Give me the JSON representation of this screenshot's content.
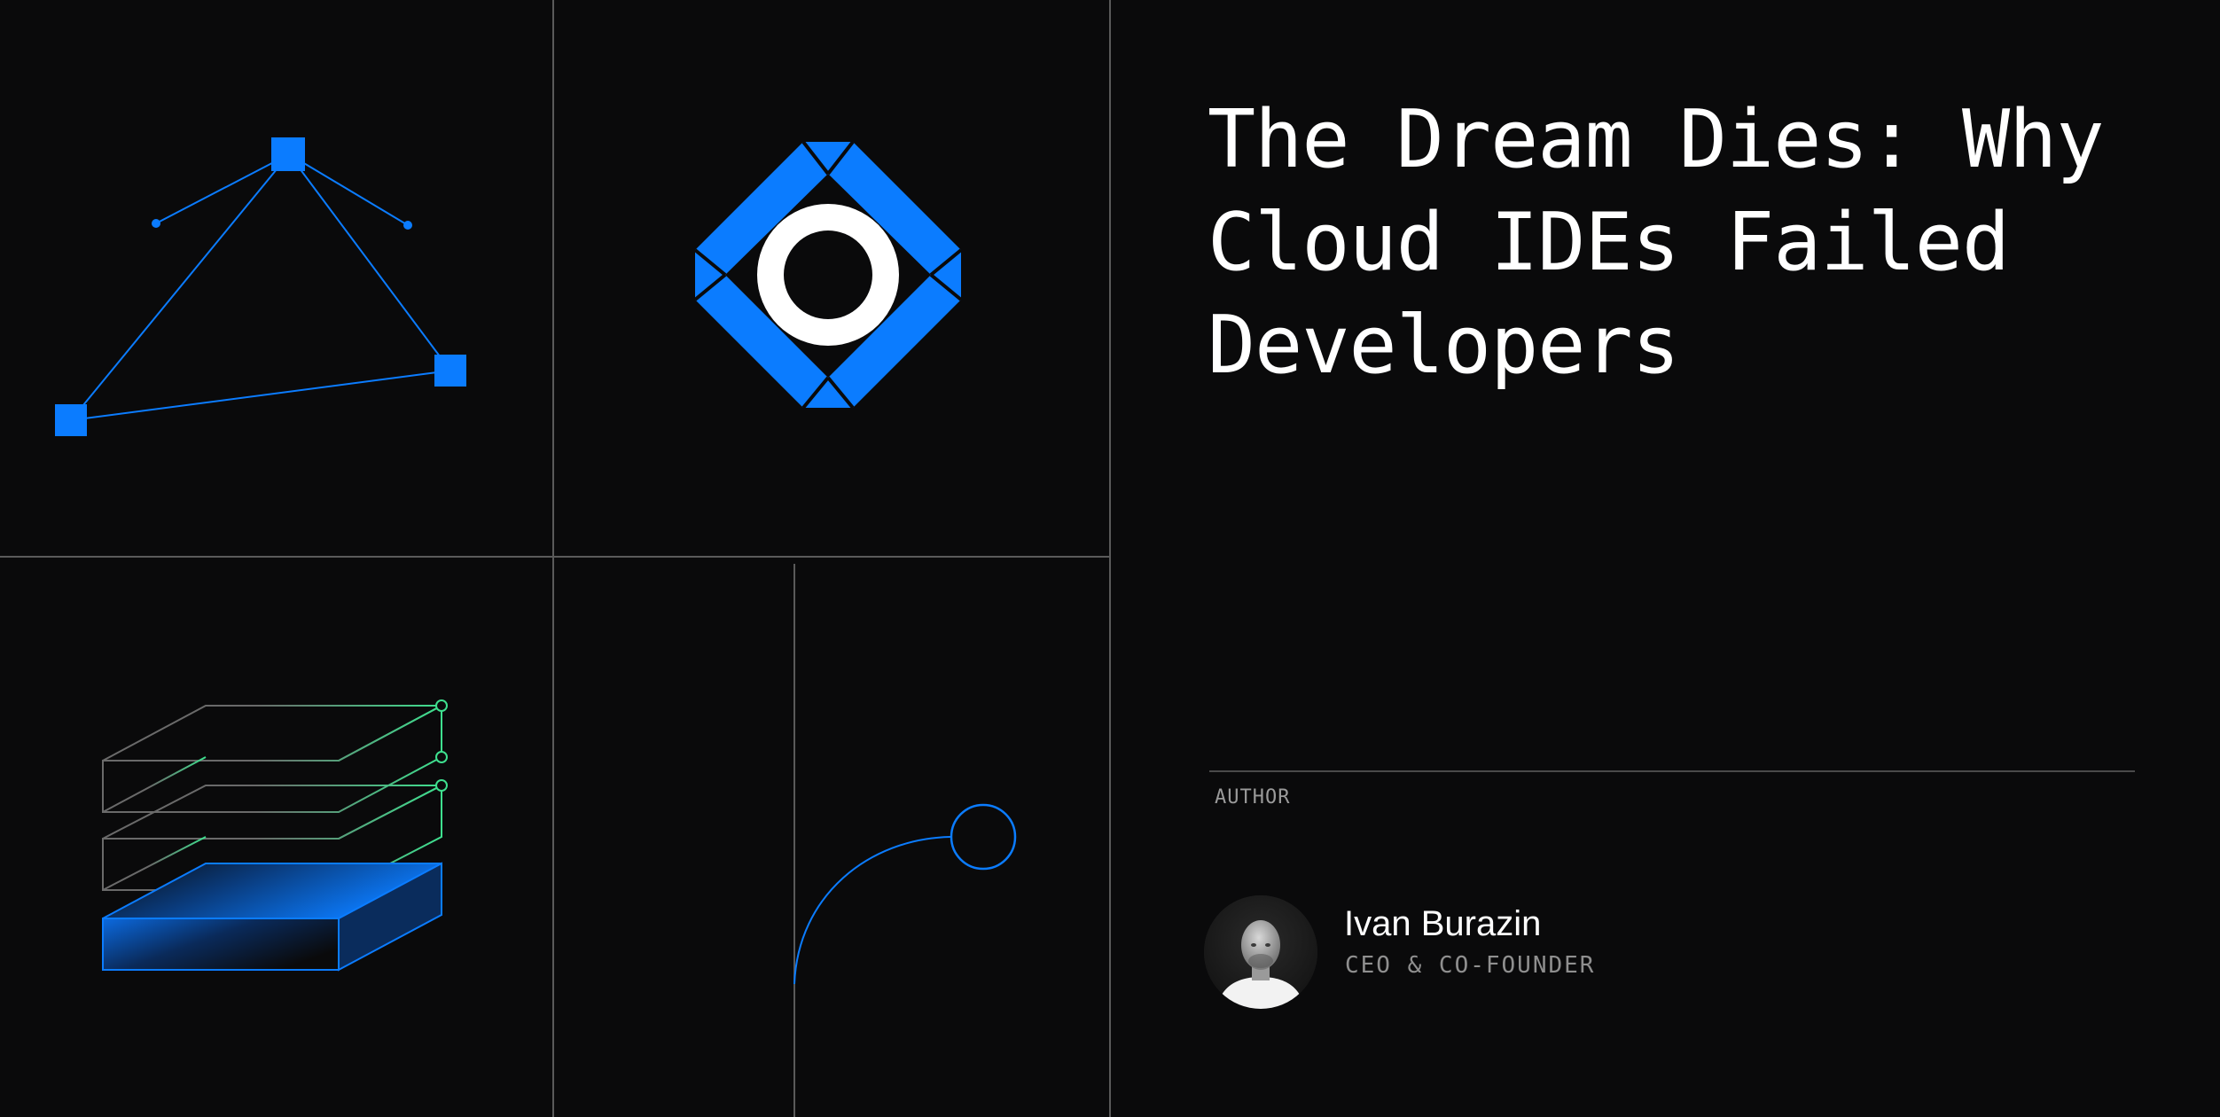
{
  "post": {
    "title": "The Dream Dies: Why Cloud IDEs Failed Developers"
  },
  "author": {
    "label": "AUTHOR",
    "name": "Ivan Burazin",
    "role": "CEO & CO-FOUNDER"
  },
  "colors": {
    "background": "#0a0a0b",
    "accent_blue": "#0b7cff",
    "accent_green": "#3ee08f",
    "grid_line": "#5a5a5a"
  },
  "icons": {
    "logo": "daytona-logo-icon",
    "network": "network-triangle-icon",
    "layers": "stacked-layers-icon",
    "arc": "arc-circle-icon"
  }
}
